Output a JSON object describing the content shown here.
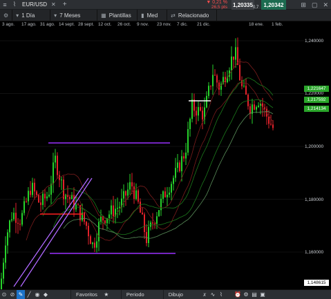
{
  "topbar": {
    "symbol": "EUR/USD",
    "change_pct": "▼ 0,21 %",
    "change_pts": "26,5 pts",
    "sell_price": "1,20335",
    "spread": "0,7",
    "buy_price": "1,20342"
  },
  "toolbar": {
    "period_label": "1 Día",
    "range_label": "7 Meses",
    "templates_label": "Plantillas",
    "chart_type_label": "Med",
    "related_label": "Relacionado"
  },
  "date_axis": [
    "3 ago.",
    "17 ago.",
    "31 ago.",
    "14 sept.",
    "28 sept.",
    "12 oct.",
    "26 oct.",
    "9 nov.",
    "23 nov.",
    "7 dic.",
    "21 dic.",
    "18 ene.",
    "1 feb."
  ],
  "price_axis": [
    "1,240000",
    "1,220000",
    "1,200000",
    "1,180000",
    "1,160000"
  ],
  "price_tags": {
    "tag1": "1,221647",
    "tag2": "1,217592",
    "tag3": "1,214134",
    "current": "1,148615"
  },
  "bottombar": {
    "favorites_label": "Favoritos",
    "period_label": "Periodo",
    "drawing_label": "Dibujo"
  },
  "colors": {
    "up": "#27d32b",
    "down": "#e2222b",
    "support": "#9b30ff",
    "accent": "#1d73c9"
  },
  "icons": {
    "menu": "hamburger-icon",
    "chart": "chart-icon",
    "add": "plus-icon",
    "settings": "gear-icon"
  }
}
